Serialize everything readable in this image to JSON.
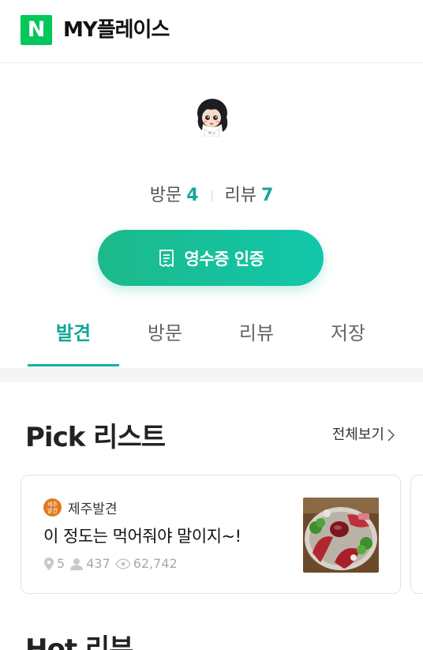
{
  "header": {
    "logo_text": "N",
    "title": "MY플레이스"
  },
  "profile": {
    "avatar_icon": "profile-character-avatar",
    "visit_label": "방문",
    "visit_count": "4",
    "review_label": "리뷰",
    "review_count": "7"
  },
  "receipt_button": {
    "label": "영수증 인증",
    "icon": "receipt-icon"
  },
  "tabs": [
    {
      "label": "발견",
      "active": true
    },
    {
      "label": "방문",
      "active": false
    },
    {
      "label": "리뷰",
      "active": false
    },
    {
      "label": "저장",
      "active": false
    }
  ],
  "pick_section": {
    "title": "Pick 리스트",
    "see_all": "전체보기"
  },
  "pick_card": {
    "author_badge": "제주\n발견",
    "author": "제주발견",
    "title": "이 정도는 먹어줘야 말이지~!",
    "places": "5",
    "followers": "437",
    "views": "62,742"
  },
  "next_section": {
    "title": "Hot 리뷰"
  },
  "colors": {
    "naver_green": "#03c75a",
    "accent_teal": "#12a596",
    "button_gradient_start": "#1cb98a",
    "button_gradient_end": "#12c7ab"
  }
}
